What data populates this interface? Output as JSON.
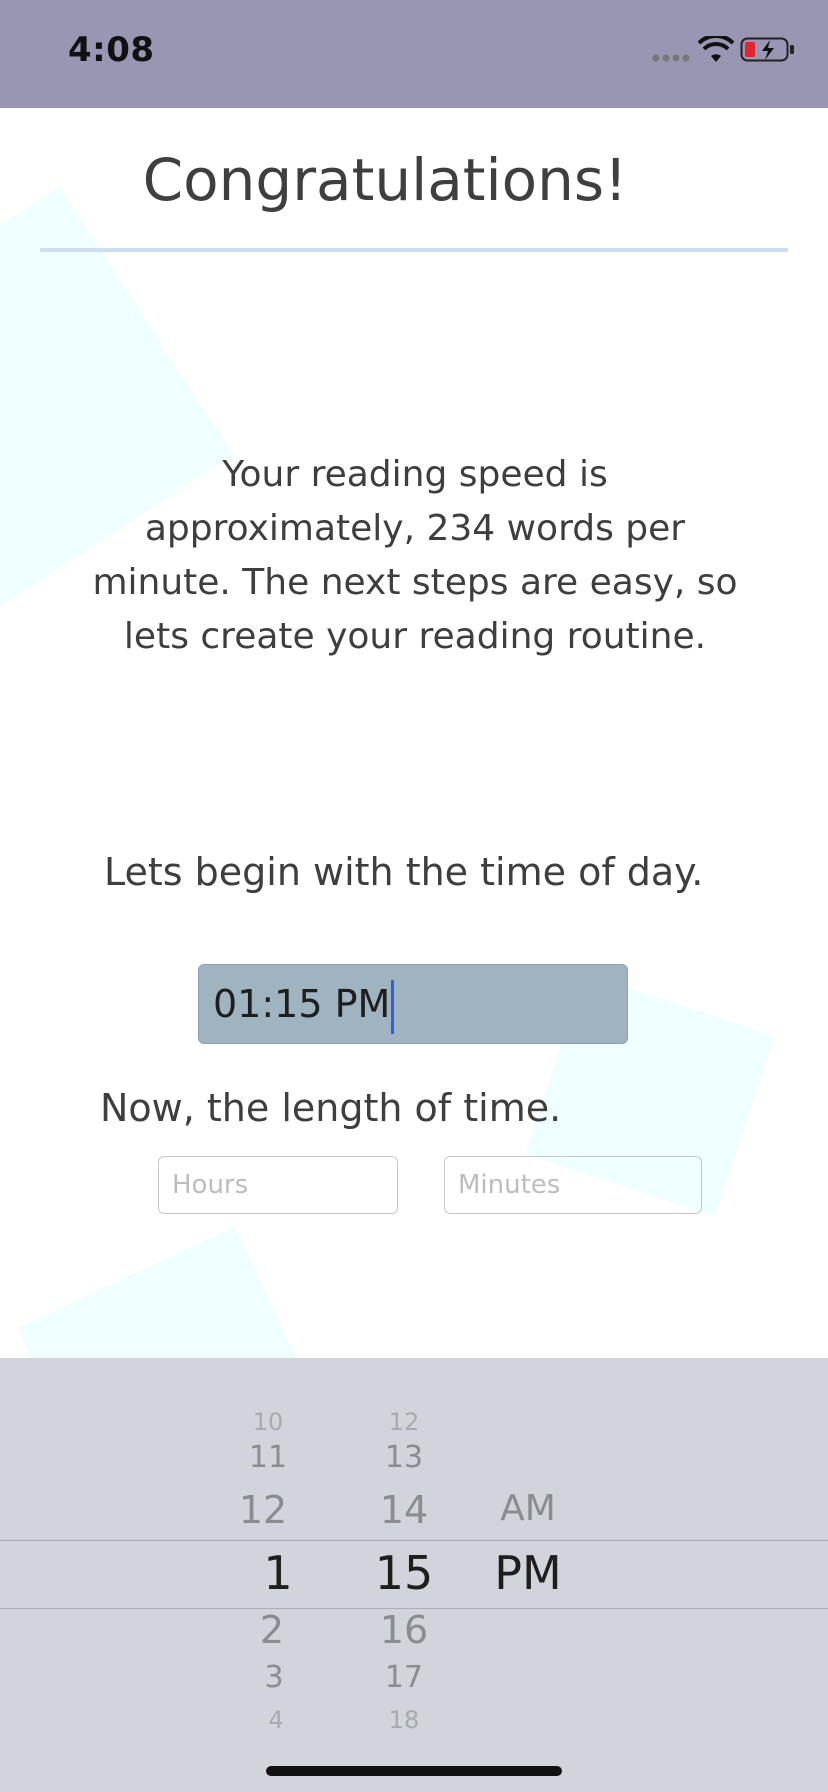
{
  "status_bar": {
    "time": "4:08",
    "icons": [
      "signal-icon",
      "wifi-icon",
      "battery-icon"
    ]
  },
  "page": {
    "title": "Congratulations!",
    "intro": "Your reading speed is approximately, 234 words per minute. The next steps are easy, so lets create your reading routine.",
    "time_prompt": "Lets begin with the time of day.",
    "time_value": "01:15 PM",
    "length_prompt": "Now, the length of time.",
    "hours_placeholder": "Hours",
    "minutes_placeholder": "Minutes"
  },
  "picker": {
    "hours": [
      "10",
      "11",
      "12",
      "1",
      "2",
      "3",
      "4"
    ],
    "minutes": [
      "12",
      "13",
      "14",
      "15",
      "16",
      "17",
      "18"
    ],
    "period": [
      "AM",
      "PM"
    ],
    "selected": {
      "hour": "1",
      "minute": "15",
      "period": "PM"
    }
  },
  "colors": {
    "status_bar": "#9896b3",
    "time_field": "#9fb3c0",
    "caret": "#2f5ee0",
    "picker_bg": "#d1d4da"
  }
}
